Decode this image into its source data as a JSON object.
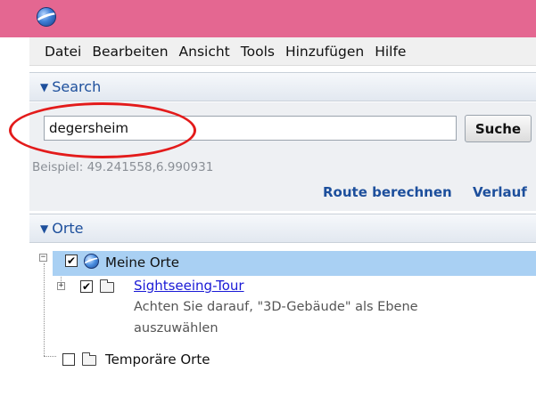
{
  "window": {
    "icon": "google-earth-icon"
  },
  "menubar": {
    "items": [
      "Datei",
      "Bearbeiten",
      "Ansicht",
      "Tools",
      "Hinzufügen",
      "Hilfe"
    ]
  },
  "search": {
    "header": "Search",
    "query": "degersheim",
    "button_label": "Suche",
    "hint": "Beispiel: 49.241558,6.990931",
    "route_link": "Route berechnen",
    "history_link": "Verlauf"
  },
  "places": {
    "header": "Orte",
    "my_places": {
      "label": "Meine Orte",
      "checked": true,
      "icon": "globe-icon"
    },
    "sightseeing": {
      "label": "Sightseeing-Tour",
      "checked": true,
      "icon": "folder-icon",
      "description_line1": "Achten Sie darauf, \"3D-Gebäude\" als Ebene",
      "description_line2": "auszuwählen"
    },
    "temporary": {
      "label": "Temporäre Orte",
      "checked": false,
      "icon": "folder-icon"
    }
  },
  "annotation": {
    "color": "#e31b1b"
  },
  "colors": {
    "titlebar": "#e46791",
    "accent": "#1d4f9c",
    "selection": "#a9d0f3"
  }
}
